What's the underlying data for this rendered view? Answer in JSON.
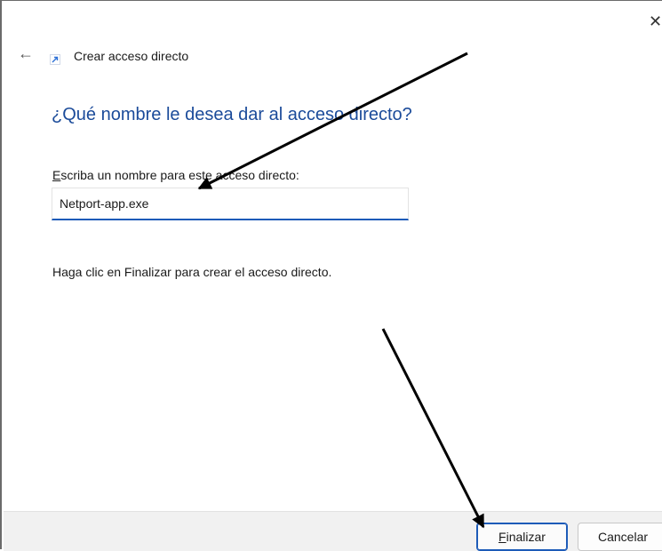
{
  "window": {
    "close_glyph": "✕"
  },
  "header": {
    "back_glyph": "←",
    "title": "Crear acceso directo"
  },
  "main": {
    "heading": "¿Qué nombre le desea dar al acceso directo?",
    "field_label_accesskey": "E",
    "field_label_rest": "scriba un nombre para este acceso directo:",
    "name_value": "Netport-app.exe",
    "hint": "Haga clic en Finalizar para crear el acceso directo."
  },
  "footer": {
    "finish_accesskey": "F",
    "finish_rest": "inalizar",
    "cancel_label": "Cancelar"
  },
  "icons": {
    "shortcut": "shortcut-arrow-icon",
    "back": "back-arrow-icon",
    "close": "close-icon"
  },
  "colors": {
    "heading": "#1b4b9a",
    "accent": "#1d5bb8",
    "footer_bg": "#f1f1f1",
    "annotation_arrow": "#000000"
  }
}
